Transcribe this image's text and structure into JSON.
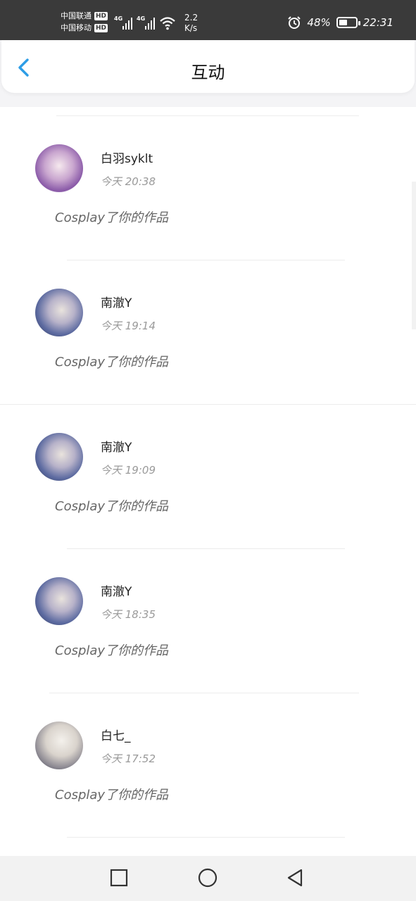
{
  "status_bar": {
    "carrier1": "中国联通",
    "carrier2": "中国移动",
    "hd": "HD",
    "net1": "4G",
    "net2": "4G",
    "speed_value": "2.2",
    "speed_unit": "K/s",
    "battery": "48%",
    "battery_level": 0.48,
    "time": "22:31",
    "icons": [
      "alarm-icon",
      "battery-icon",
      "wifi-icon",
      "signal-icon"
    ]
  },
  "header": {
    "title": "互动",
    "back_icon": "chevron-left-icon",
    "accent_color": "#2d9de6"
  },
  "interactions": [
    {
      "name": "白羽syklt",
      "time": "今天 20:38",
      "message": "Cosplay了你的作品"
    },
    {
      "name": "南澈Y",
      "time": "今天 19:14",
      "message": "Cosplay了你的作品"
    },
    {
      "name": "南澈Y",
      "time": "今天 19:09",
      "message": "Cosplay了你的作品"
    },
    {
      "name": "南澈Y",
      "time": "今天 18:35",
      "message": "Cosplay了你的作品"
    },
    {
      "name": "白七_",
      "time": "今天 17:52",
      "message": "Cosplay了你的作品"
    }
  ],
  "nav": {
    "icons": [
      "square-recent-icon",
      "circle-home-icon",
      "triangle-back-icon"
    ]
  }
}
